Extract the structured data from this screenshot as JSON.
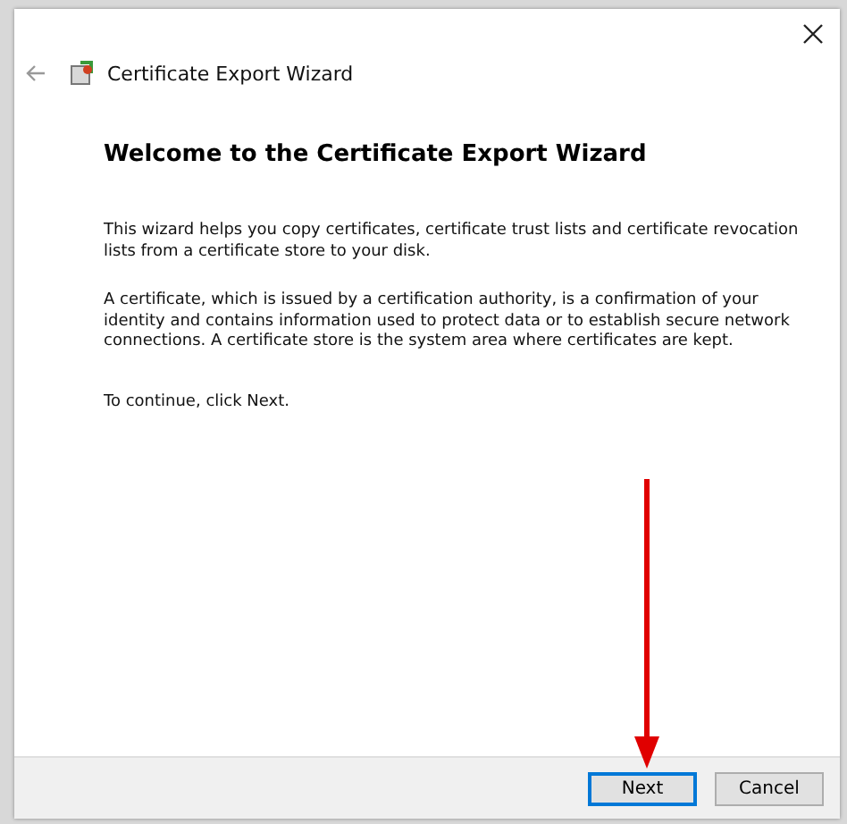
{
  "window": {
    "title": "Certificate Export Wizard"
  },
  "heading": "Welcome to the Certificate Export Wizard",
  "paragraphs": [
    "This wizard helps you copy certificates, certificate trust lists and certificate revocation lists from a certificate store to your disk.",
    "A certificate, which is issued by a certification authority, is a confirmation of your identity and contains information used to protect data or to establish secure network connections. A certificate store is the system area where certificates are kept.",
    "To continue, click Next."
  ],
  "buttons": [
    {
      "label": "Next",
      "default": true
    },
    {
      "label": "Cancel",
      "default": false
    }
  ]
}
